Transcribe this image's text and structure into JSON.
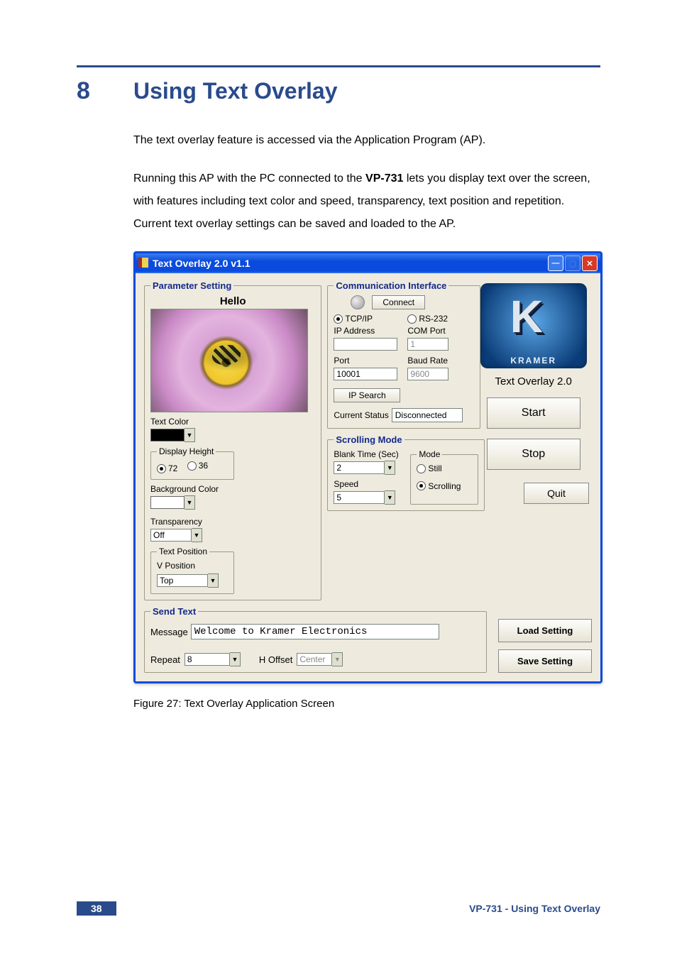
{
  "page": {
    "number_label": "38",
    "footer_title": "VP-731 - Using Text Overlay",
    "section_number": "8",
    "section_title": "Using Text Overlay",
    "paragraph1": "The text overlay feature is accessed via the Application Program (AP).",
    "paragraph2_a": "Running this AP with the PC connected to the ",
    "paragraph2_bold": "VP-731",
    "paragraph2_b": " lets you display text over the screen, with features including text color and speed, transparency, text position and repetition. Current text overlay settings can be saved and loaded to the AP.",
    "figure_caption": "Figure 27: Text Overlay Application Screen"
  },
  "window": {
    "title": "Text Overlay 2.0  v1.1",
    "logo_brand": "KRAMER",
    "side_label": "Text Overlay 2.0",
    "buttons": {
      "start": "Start",
      "stop": "Stop",
      "quit": "Quit",
      "load_setting": "Load Setting",
      "save_setting": "Save Setting",
      "connect": "Connect",
      "ip_search": "IP Search"
    }
  },
  "parameter_setting": {
    "legend": "Parameter Setting",
    "preview_text": "Hello",
    "text_color_label": "Text Color",
    "display_height": {
      "legend": "Display Height",
      "opt72": "72",
      "opt36": "36",
      "selected": "72"
    },
    "background_color_label": "Background Color",
    "text_position": {
      "legend": "Text Position",
      "vposition_label": "V Position",
      "vposition_value": "Top"
    },
    "transparency": {
      "label": "Transparency",
      "value": "Off"
    }
  },
  "communication_interface": {
    "legend": "Communication Interface",
    "tcp_label": "TCP/IP",
    "rs232_label": "RS-232",
    "selected_mode": "TCP/IP",
    "ip_address_label": "IP Address",
    "ip_address_value": "",
    "com_port_label": "COM Port",
    "com_port_value": "1",
    "port_label": "Port",
    "port_value": "10001",
    "baud_rate_label": "Baud Rate",
    "baud_rate_value": "9600",
    "current_status_label": "Current Status",
    "current_status_value": "Disconnected"
  },
  "scrolling_mode": {
    "legend": "Scrolling Mode",
    "blank_time_label": "Blank Time (Sec)",
    "blank_time_value": "2",
    "speed_label": "Speed",
    "speed_value": "5",
    "mode": {
      "legend": "Mode",
      "still_label": "Still",
      "scrolling_label": "Scrolling",
      "selected": "Scrolling"
    }
  },
  "send_text": {
    "legend": "Send Text",
    "message_label": "Message",
    "message_value": "Welcome to Kramer Electronics",
    "repeat_label": "Repeat",
    "repeat_value": "8",
    "h_offset_label": "H Offset",
    "h_offset_value": "Center"
  }
}
